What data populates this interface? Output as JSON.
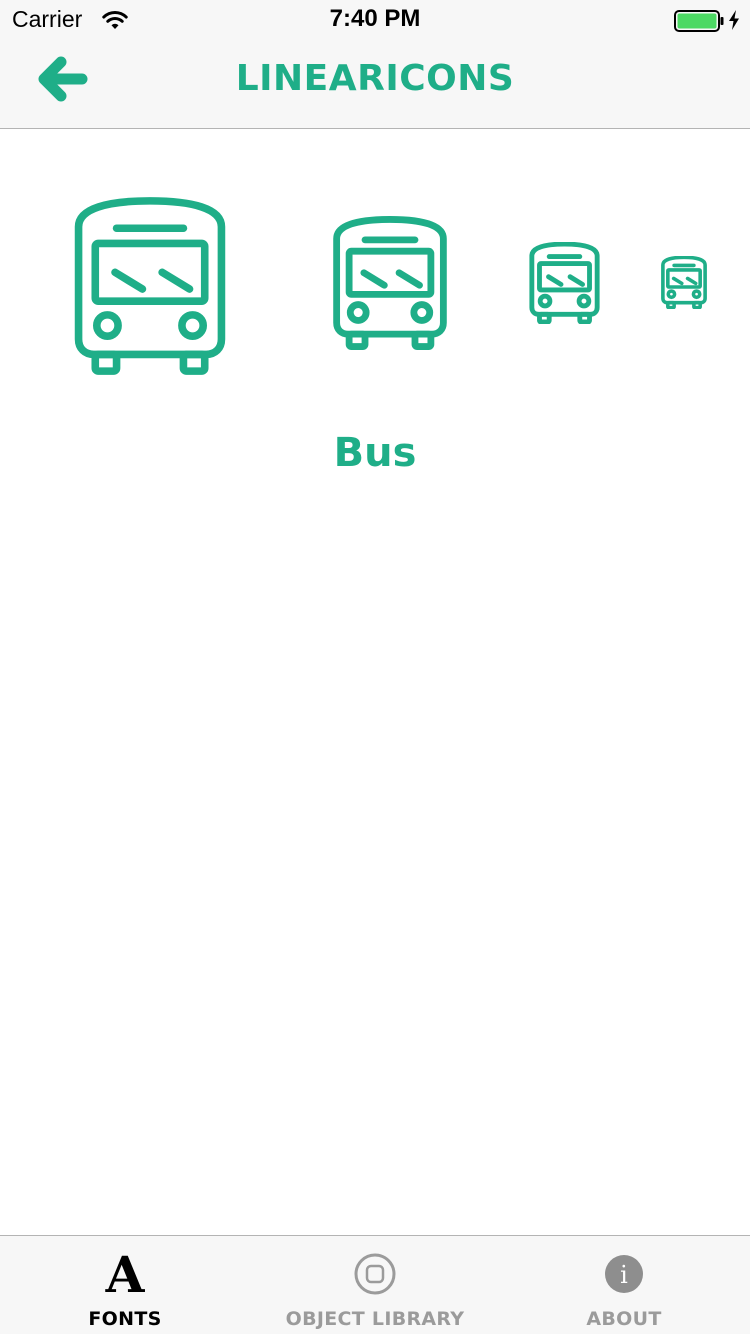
{
  "status_bar": {
    "carrier": "Carrier",
    "time": "7:40 PM",
    "wifi_icon": "wifi-icon",
    "battery_icon": "battery-full-charging-icon",
    "battery_color": "#4cd964"
  },
  "nav": {
    "title": "LINEARICONS",
    "back_icon": "arrow-left-icon"
  },
  "content": {
    "icon_name": "Bus",
    "icon_semantic": "bus-icon",
    "icon_color": "#1fae88"
  },
  "tabbar": {
    "tabs": [
      {
        "label": "FONTS",
        "icon": "font-letter-a-icon",
        "selected": true
      },
      {
        "label": "OBJECT LIBRARY",
        "icon": "object-library-icon",
        "selected": false
      },
      {
        "label": "ABOUT",
        "icon": "info-icon",
        "selected": false
      }
    ],
    "font_glyph": "A",
    "about_glyph": "i"
  }
}
